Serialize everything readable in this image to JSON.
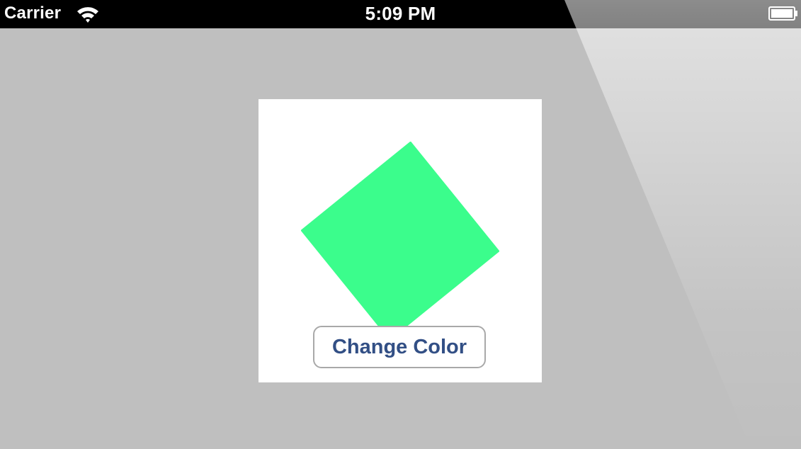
{
  "status_bar": {
    "carrier": "Carrier",
    "time": "5:09 PM",
    "wifi_icon": "wifi-icon",
    "battery_icon": "battery-icon"
  },
  "app": {
    "canvas_background": "#ffffff",
    "square_color": "#3bfd8c",
    "square_rotation_degrees": -39,
    "button_label": "Change Color",
    "button_text_color": "#324f85"
  },
  "colors": {
    "background": "#bfbfbf",
    "status_bar": "#000000"
  }
}
